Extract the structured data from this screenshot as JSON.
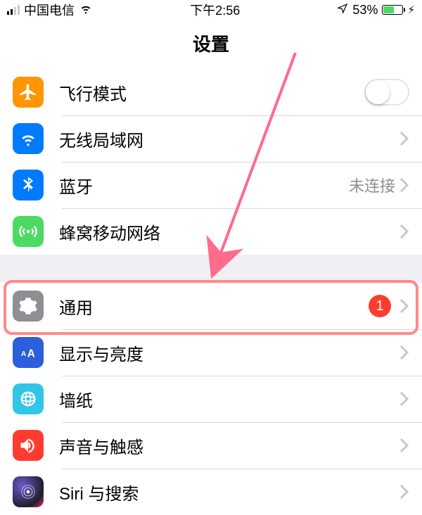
{
  "status": {
    "carrier": "中国电信",
    "time": "下午2:56",
    "battery_pct": "53%"
  },
  "title": "设置",
  "group1": {
    "airplane": "飞行模式",
    "wifi": "无线局域网",
    "bluetooth": "蓝牙",
    "bluetooth_status": "未连接",
    "cellular": "蜂窝移动网络"
  },
  "group2": {
    "general": "通用",
    "general_badge": "1",
    "display": "显示与亮度",
    "wallpaper": "墙纸",
    "sound": "声音与触感",
    "siri": "Siri 与搜索"
  }
}
